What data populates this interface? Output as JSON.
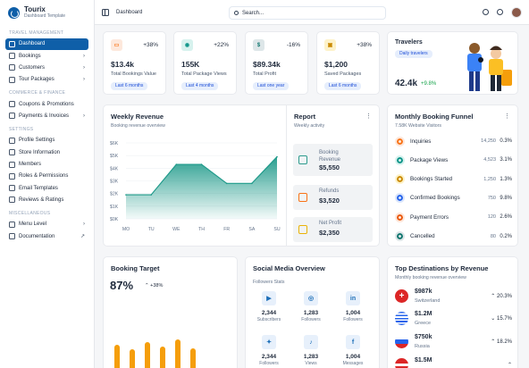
{
  "brand": {
    "name": "Tourix",
    "subtitle": "Dashboard Template"
  },
  "sidebar": {
    "sections": [
      {
        "title": "TRAVEL MANAGEMENT",
        "items": [
          {
            "label": "Dashboard",
            "active": true,
            "chevron": false
          },
          {
            "label": "Bookings",
            "chevron": true
          },
          {
            "label": "Customers",
            "chevron": true
          },
          {
            "label": "Tour Packages",
            "chevron": true
          }
        ]
      },
      {
        "title": "COMMERCE & FINANCE",
        "items": [
          {
            "label": "Coupons & Promotions",
            "chevron": false
          },
          {
            "label": "Payments & Invoices",
            "chevron": true
          }
        ]
      },
      {
        "title": "SETTINGS",
        "items": [
          {
            "label": "Profile Settings",
            "chevron": false
          },
          {
            "label": "Store Information",
            "chevron": false
          },
          {
            "label": "Members",
            "chevron": false
          },
          {
            "label": "Roles & Permissions",
            "chevron": false
          },
          {
            "label": "Email Templates",
            "chevron": false
          },
          {
            "label": "Reviews & Ratings",
            "chevron": false
          }
        ]
      },
      {
        "title": "MISCELLANEOUS",
        "items": [
          {
            "label": "Menu Level",
            "chevron": true
          },
          {
            "label": "Documentation",
            "chevron": false,
            "external": true
          }
        ]
      }
    ]
  },
  "topbar": {
    "title": "Dashboard",
    "search_placeholder": "Search..."
  },
  "stats": [
    {
      "value": "$13.4k",
      "label": "Total Bookings Value",
      "change": "+38%",
      "period": "Last 6 months",
      "color": "#f97316",
      "bg": "#fde8dc"
    },
    {
      "value": "155K",
      "label": "Total Package Views",
      "change": "+22%",
      "period": "Last 4 months",
      "color": "#0d9488",
      "bg": "#d7f2ee"
    },
    {
      "value": "$89.34k",
      "label": "Total Profit",
      "change": "-16%",
      "period": "Last one year",
      "color": "#0f766e",
      "bg": "#dde6e8"
    },
    {
      "value": "$1,200",
      "label": "Saved Packages",
      "change": "+38%",
      "period": "Last 6 months",
      "color": "#ca8a04",
      "bg": "#fdf2c9"
    }
  ],
  "travelers": {
    "title": "Travelers",
    "badge": "Daily travelers",
    "value": "42.4k",
    "change": "+9.8%"
  },
  "weekly_revenue": {
    "title": "Weekly Revenue",
    "subtitle": "Booking revenue overview"
  },
  "chart_data": {
    "type": "area",
    "title": "Weekly Revenue",
    "subtitle": "Booking revenue overview",
    "categories": [
      "MO",
      "TU",
      "WE",
      "TH",
      "FR",
      "SA",
      "SU"
    ],
    "yticks": [
      "$0K",
      "$1K",
      "$2K",
      "$3K",
      "$4K",
      "$5K",
      "$6K"
    ],
    "ylim": [
      0,
      6
    ],
    "values": [
      1.9,
      1.9,
      4.3,
      4.3,
      2.8,
      2.8,
      4.9
    ],
    "color": "#1f9a8a"
  },
  "report": {
    "title": "Report",
    "subtitle": "Weekly activity",
    "items": [
      {
        "label": "Booking Revenue",
        "value": "$5,550",
        "color": "#2e9c8e"
      },
      {
        "label": "Refunds",
        "value": "$3,520",
        "color": "#f97316"
      },
      {
        "label": "Net Profit",
        "value": "$2,350",
        "color": "#eab308"
      }
    ]
  },
  "funnel": {
    "title": "Monthly Booking Funnel",
    "subtitle": "7.58K Website Visitors",
    "rows": [
      {
        "label": "Inquiries",
        "count": "14,250",
        "pct": "0.3%",
        "color": "#f97316",
        "bg": "#fde8dc"
      },
      {
        "label": "Package Views",
        "count": "4,523",
        "pct": "3.1%",
        "color": "#0d9488",
        "bg": "#d7f2ee"
      },
      {
        "label": "Bookings Started",
        "count": "1,250",
        "pct": "1.3%",
        "color": "#ca8a04",
        "bg": "#fdf2c9"
      },
      {
        "label": "Confirmed Bookings",
        "count": "750",
        "pct": "9.8%",
        "color": "#2563eb",
        "bg": "#dbe6fb"
      },
      {
        "label": "Payment Errors",
        "count": "120",
        "pct": "2.6%",
        "color": "#ea580c",
        "bg": "#fde8dc"
      },
      {
        "label": "Cancelled",
        "count": "80",
        "pct": "0.2%",
        "color": "#0f766e",
        "bg": "#dde6e8"
      }
    ]
  },
  "booking_target": {
    "title": "Booking Target",
    "value": "87%",
    "change": "+38%"
  },
  "social": {
    "title": "Social Media Overview",
    "subtitle": "Followers Stats",
    "items": [
      {
        "icon": "youtube-icon",
        "glyph": "▶",
        "value": "2,344",
        "label": "Subscribers"
      },
      {
        "icon": "instagram-icon",
        "glyph": "◎",
        "value": "1,283",
        "label": "Followers"
      },
      {
        "icon": "linkedin-icon",
        "glyph": "in",
        "value": "1,004",
        "label": "Followers"
      },
      {
        "icon": "twitter-icon",
        "glyph": "✦",
        "value": "2,344",
        "label": "Followers"
      },
      {
        "icon": "tiktok-icon",
        "glyph": "♪",
        "value": "1,283",
        "label": "Views"
      },
      {
        "icon": "facebook-icon",
        "glyph": "f",
        "value": "1,004",
        "label": "Messages"
      }
    ]
  },
  "destinations": {
    "title": "Top Destinations by Revenue",
    "subtitle": "Monthly booking revenue overview",
    "rows": [
      {
        "value": "$987k",
        "name": "Switzerland",
        "pct": "20.3%",
        "dir": "up"
      },
      {
        "value": "$1.2M",
        "name": "Greece",
        "pct": "15.7%",
        "dir": "down"
      },
      {
        "value": "$750k",
        "name": "Russia",
        "pct": "18.2%",
        "dir": "up"
      },
      {
        "value": "$1.5M",
        "name": "",
        "pct": "",
        "dir": "up"
      }
    ]
  }
}
